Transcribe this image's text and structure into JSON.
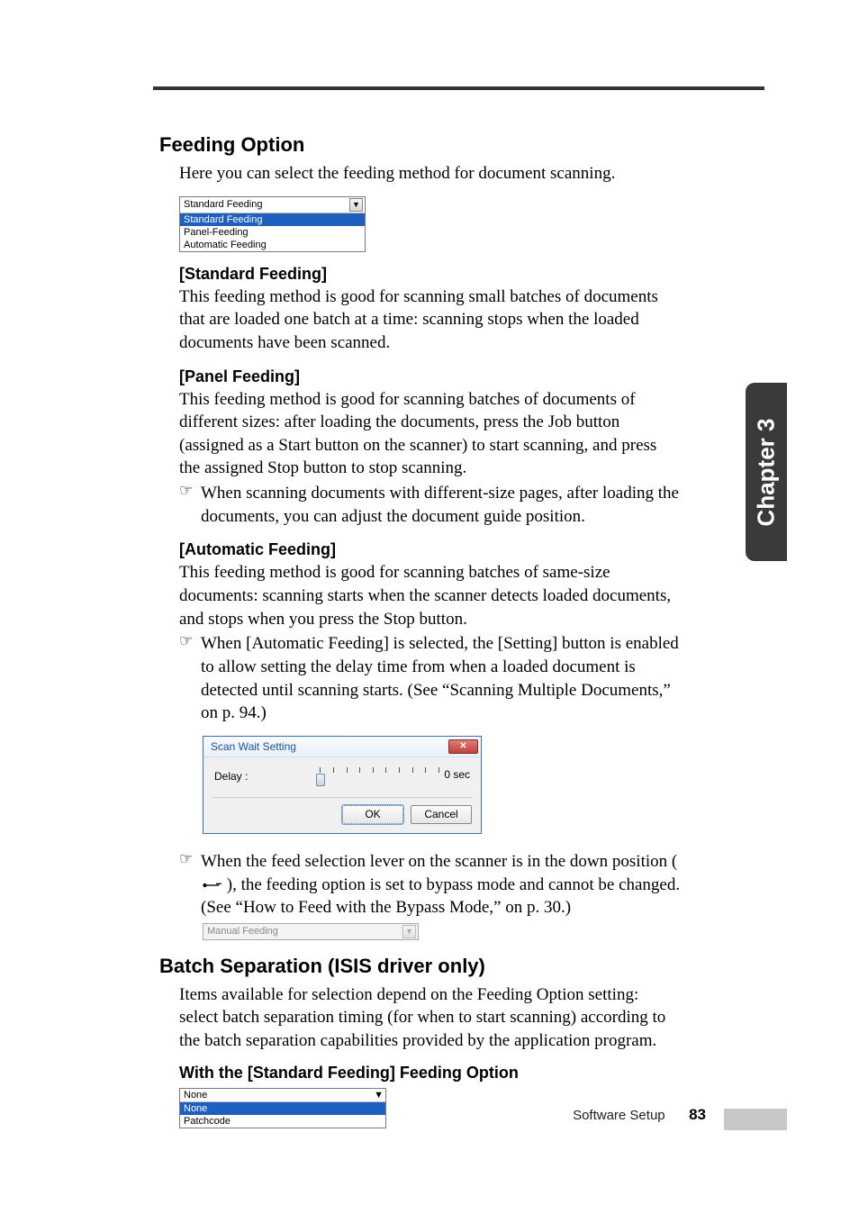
{
  "sideTab": "Chapter 3",
  "footer": {
    "label": "Software Setup",
    "page": "83"
  },
  "s1": {
    "title": "Feeding Option",
    "intro": "Here you can select the feeding method for document scanning.",
    "dropdown": {
      "selected": "Standard Feeding",
      "options": [
        "Standard Feeding",
        "Panel-Feeding",
        "Automatic Feeding"
      ],
      "hlIndex": 0
    },
    "std": {
      "h": "[Standard Feeding]",
      "p": "This feeding method is good for scanning small batches of documents that are loaded one batch at a time: scanning stops when the loaded documents have been scanned."
    },
    "panel": {
      "h": "[Panel Feeding]",
      "p": "This feeding method is good for scanning batches of documents of different sizes: after loading the documents, press the Job button (assigned as a Start button on the scanner) to start scanning, and press the assigned Stop button to stop scanning.",
      "note": "When scanning documents with different-size pages, after loading the documents, you can adjust the document guide position."
    },
    "auto": {
      "h": "[Automatic Feeding]",
      "p": "This feeding method is good for scanning batches of same-size documents: scanning starts when the scanner detects loaded documents, and stops when you press the Stop button.",
      "note1": "When [Automatic Feeding] is selected, the [Setting] button is enabled to allow setting the delay time from when a loaded document is detected until scanning starts. (See “Scanning Multiple Documents,” on p. 94.)",
      "dialog": {
        "title": "Scan Wait Setting",
        "delayLabel": "Delay :",
        "value": "0 sec",
        "ok": "OK",
        "cancel": "Cancel"
      },
      "note2a": "When the feed selection lever on the scanner is in the down position (",
      "note2b": "), the feeding option is set to bypass mode and cannot be changed. (See “How to Feed with the Bypass Mode,” on p. 30.)",
      "manual": "Manual Feeding"
    }
  },
  "s2": {
    "title": "Batch Separation (ISIS driver only)",
    "intro": "Items available for selection depend on the Feeding Option setting: select batch separation timing (for when to start scanning) according to the batch separation capabilities provided by the application program.",
    "std_h": "With the [Standard Feeding] Feeding Option",
    "dropdown": {
      "selected": "None",
      "options": [
        "None",
        "Patchcode"
      ],
      "hlIndex": 0
    }
  },
  "noteMark": "☞"
}
